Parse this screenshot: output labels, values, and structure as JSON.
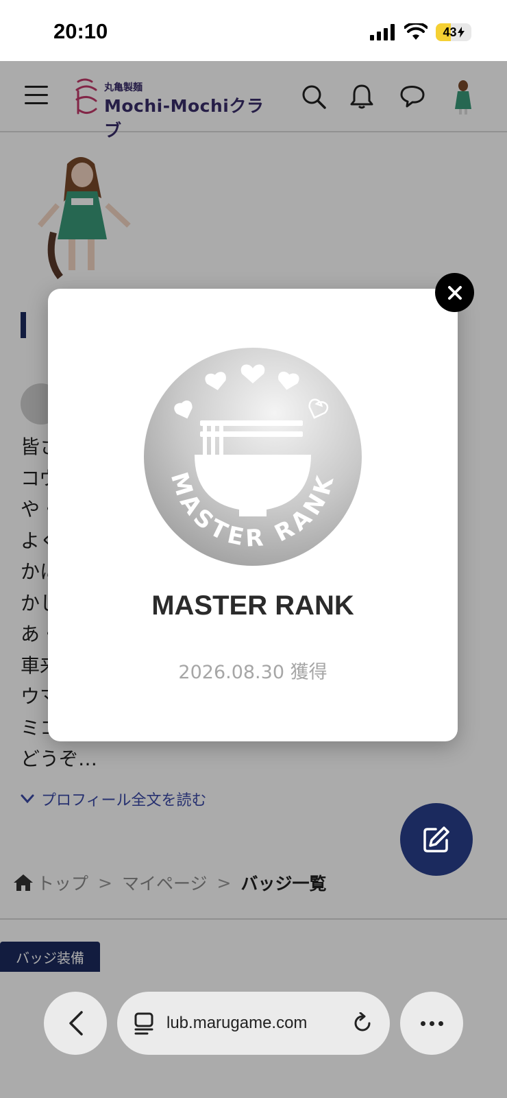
{
  "status_bar": {
    "time": "20:10",
    "battery": "43"
  },
  "header": {
    "logo_small": "丸亀製麺",
    "logo_main": "Mochi-Mochiクラブ",
    "icons": [
      "menu-icon",
      "search-icon",
      "bell-icon",
      "chat-icon",
      "avatar"
    ]
  },
  "profile": {
    "body_lines": [
      "皆さ",
      "コウ",
      "や・",
      "よく",
      "かに",
      "かし",
      "あ・",
      "車来",
      "ウマ",
      "ミコ",
      "どうぞ…"
    ],
    "read_more": "プロフィール全文を読む"
  },
  "breadcrumb": {
    "home": "トップ",
    "mypage": "マイページ",
    "current": "バッジ一覧",
    "separator": ">"
  },
  "tabs": {
    "badge_equip": "バッジ装備"
  },
  "modal": {
    "medal_text": "MASTER RANK",
    "title": "MASTER RANK",
    "acquired": "2026.08.30 獲得"
  },
  "browser": {
    "url": "lub.marugame.com"
  },
  "colors": {
    "brand_navy": "#1b2a5e",
    "logo_purple": "#3a2d6a",
    "logo_pink": "#c23a6a",
    "link_blue": "#3b4aa8"
  }
}
